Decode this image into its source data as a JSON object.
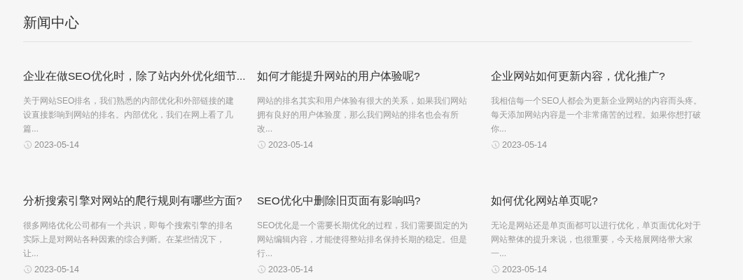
{
  "heading": "新闻中心",
  "articles": [
    {
      "title": "企业在做SEO优化时，除了站内外优化细节...",
      "summary": "关于网站SEO排名，我们熟悉的内部优化和外部链接的建设直接影响到网站的排名。内部优化，我们在网上看了几篇...",
      "date": "2023-05-14"
    },
    {
      "title": "如何才能提升网站的用户体验呢?",
      "summary": "网站的排名其实和用户体验有很大的关系，如果我们网站拥有良好的用户体验度，那么我们网站的排名也会有所改...",
      "date": "2023-05-14"
    },
    {
      "title": "企业网站如何更新内容，优化推广?",
      "summary": "我相信每一个SEO人都会为更新企业网站的内容而头疼。每天添加网站内容是一个非常痛苦的过程。如果你想打破你...",
      "date": "2023-05-14"
    },
    {
      "title": "分析搜索引擎对网站的爬行规则有哪些方面?",
      "summary": "很多网络优化公司都有一个共识，即每个搜索引擎的排名实际上是对网站各种因素的综合判断。在某些情况下，让...",
      "date": "2023-05-14"
    },
    {
      "title": "SEO优化中删除旧页面有影响吗?",
      "summary": "SEO优化是一个需要长期优化的过程，我们需要固定的为网站编辑内容，才能使得整站排名保持长期的稳定。但是行...",
      "date": "2023-05-14"
    },
    {
      "title": "如何优化网站单页呢?",
      "summary": "无论是网站还是单页面都可以进行优化，单页面优化对于网站整体的提升来说，也很重要，今天格展网络带大家一...",
      "date": "2023-05-14"
    }
  ]
}
